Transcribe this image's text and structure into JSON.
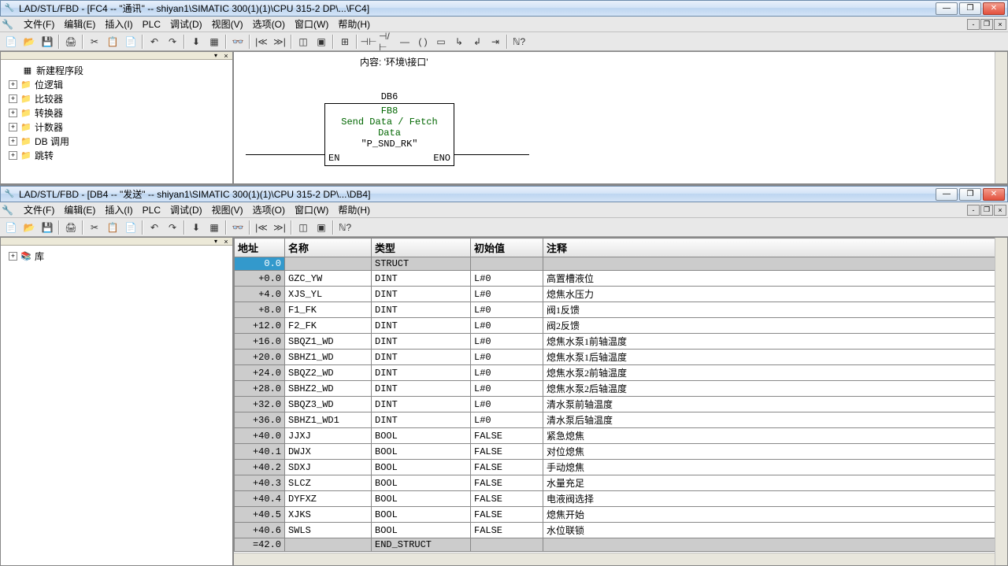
{
  "top": {
    "title": "LAD/STL/FBD  - [FC4 -- \"通讯\" -- shiyan1\\SIMATIC 300(1)(1)\\CPU 315-2 DP\\...\\FC4]",
    "menus": [
      "文件(F)",
      "编辑(E)",
      "插入(I)",
      "PLC",
      "调试(D)",
      "视图(V)",
      "选项(O)",
      "窗口(W)",
      "帮助(H)"
    ],
    "tree": [
      {
        "label": "新建程序段",
        "icon": "net"
      },
      {
        "label": "位逻辑",
        "icon": "folder"
      },
      {
        "label": "比较器",
        "icon": "folder"
      },
      {
        "label": "转换器",
        "icon": "folder"
      },
      {
        "label": "计数器",
        "icon": "folder"
      },
      {
        "label": "DB 调用",
        "icon": "folder"
      },
      {
        "label": "跳转",
        "icon": "folder"
      }
    ],
    "content_label": "内容:  '环境\\接口'",
    "block": {
      "db": "DB6",
      "fb": "FB8",
      "line1": "Send Data / Fetch",
      "line2": "Data",
      "name": "\"P_SND_RK\"",
      "en": "EN",
      "eno": "ENO"
    }
  },
  "bottom": {
    "title": "LAD/STL/FBD  - [DB4 -- \"发送\" -- shiyan1\\SIMATIC 300(1)(1)\\CPU 315-2 DP\\...\\DB4]",
    "menus": [
      "文件(F)",
      "编辑(E)",
      "插入(I)",
      "PLC",
      "调试(D)",
      "视图(V)",
      "选项(O)",
      "窗口(W)",
      "帮助(H)"
    ],
    "tree": [
      {
        "label": "库",
        "icon": "book"
      }
    ],
    "columns": [
      "地址",
      "名称",
      "类型",
      "初始值",
      "注释"
    ],
    "rows": [
      {
        "addr": "0.0",
        "name": "",
        "type": "STRUCT",
        "init": "",
        "comment": "",
        "sel": true,
        "gray": true
      },
      {
        "addr": "+0.0",
        "name": "GZC_YW",
        "type": "DINT",
        "init": "L#0",
        "comment": "高置槽液位"
      },
      {
        "addr": "+4.0",
        "name": "XJS_YL",
        "type": "DINT",
        "init": "L#0",
        "comment": "熄焦水压力"
      },
      {
        "addr": "+8.0",
        "name": "F1_FK",
        "type": "DINT",
        "init": "L#0",
        "comment": "阀1反馈"
      },
      {
        "addr": "+12.0",
        "name": "F2_FK",
        "type": "DINT",
        "init": "L#0",
        "comment": "阀2反馈"
      },
      {
        "addr": "+16.0",
        "name": "SBQZ1_WD",
        "type": "DINT",
        "init": "L#0",
        "comment": "熄焦水泵1前轴温度"
      },
      {
        "addr": "+20.0",
        "name": "SBHZ1_WD",
        "type": "DINT",
        "init": "L#0",
        "comment": "熄焦水泵1后轴温度"
      },
      {
        "addr": "+24.0",
        "name": "SBQZ2_WD",
        "type": "DINT",
        "init": "L#0",
        "comment": "熄焦水泵2前轴温度"
      },
      {
        "addr": "+28.0",
        "name": "SBHZ2_WD",
        "type": "DINT",
        "init": "L#0",
        "comment": "熄焦水泵2后轴温度"
      },
      {
        "addr": "+32.0",
        "name": "SBQZ3_WD",
        "type": "DINT",
        "init": "L#0",
        "comment": "清水泵前轴温度"
      },
      {
        "addr": "+36.0",
        "name": "SBHZ1_WD1",
        "type": "DINT",
        "init": "L#0",
        "comment": "清水泵后轴温度"
      },
      {
        "addr": "+40.0",
        "name": "JJXJ",
        "type": "BOOL",
        "init": "FALSE",
        "comment": "紧急熄焦"
      },
      {
        "addr": "+40.1",
        "name": "DWJX",
        "type": "BOOL",
        "init": "FALSE",
        "comment": "对位熄焦"
      },
      {
        "addr": "+40.2",
        "name": "SDXJ",
        "type": "BOOL",
        "init": "FALSE",
        "comment": "手动熄焦"
      },
      {
        "addr": "+40.3",
        "name": "SLCZ",
        "type": "BOOL",
        "init": "FALSE",
        "comment": "水量充足"
      },
      {
        "addr": "+40.4",
        "name": "DYFXZ",
        "type": "BOOL",
        "init": "FALSE",
        "comment": "电液阀选择"
      },
      {
        "addr": "+40.5",
        "name": "XJKS",
        "type": "BOOL",
        "init": "FALSE",
        "comment": "熄焦开始"
      },
      {
        "addr": "+40.6",
        "name": "SWLS",
        "type": "BOOL",
        "init": "FALSE",
        "comment": "水位联锁"
      },
      {
        "addr": "=42.0",
        "name": "",
        "type": "END_STRUCT",
        "init": "",
        "comment": "",
        "gray": true
      }
    ]
  }
}
